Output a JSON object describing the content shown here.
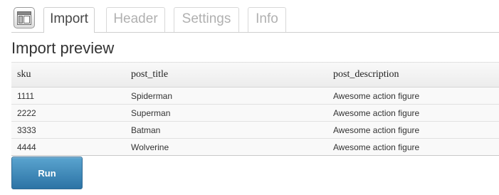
{
  "tabs": [
    {
      "label": "Import",
      "active": true
    },
    {
      "label": "Header",
      "active": false
    },
    {
      "label": "Settings",
      "active": false
    },
    {
      "label": "Info",
      "active": false
    }
  ],
  "page_title": "Import preview",
  "table": {
    "columns": [
      "sku",
      "post_title",
      "post_description"
    ],
    "rows": [
      [
        "1111",
        "Spiderman",
        "Awesome action figure"
      ],
      [
        "2222",
        "Superman",
        "Awesome action figure"
      ],
      [
        "3333",
        "Batman",
        "Awesome action figure"
      ],
      [
        "4444",
        "Wolverine",
        "Awesome action figure"
      ]
    ]
  },
  "run_button_label": "Run",
  "colors": {
    "button_top": "#5aa4cf",
    "button_bottom": "#2c73a5",
    "tab_inactive_text": "#b0b0b0"
  },
  "icons": {
    "app_icon": "layout-icon"
  }
}
